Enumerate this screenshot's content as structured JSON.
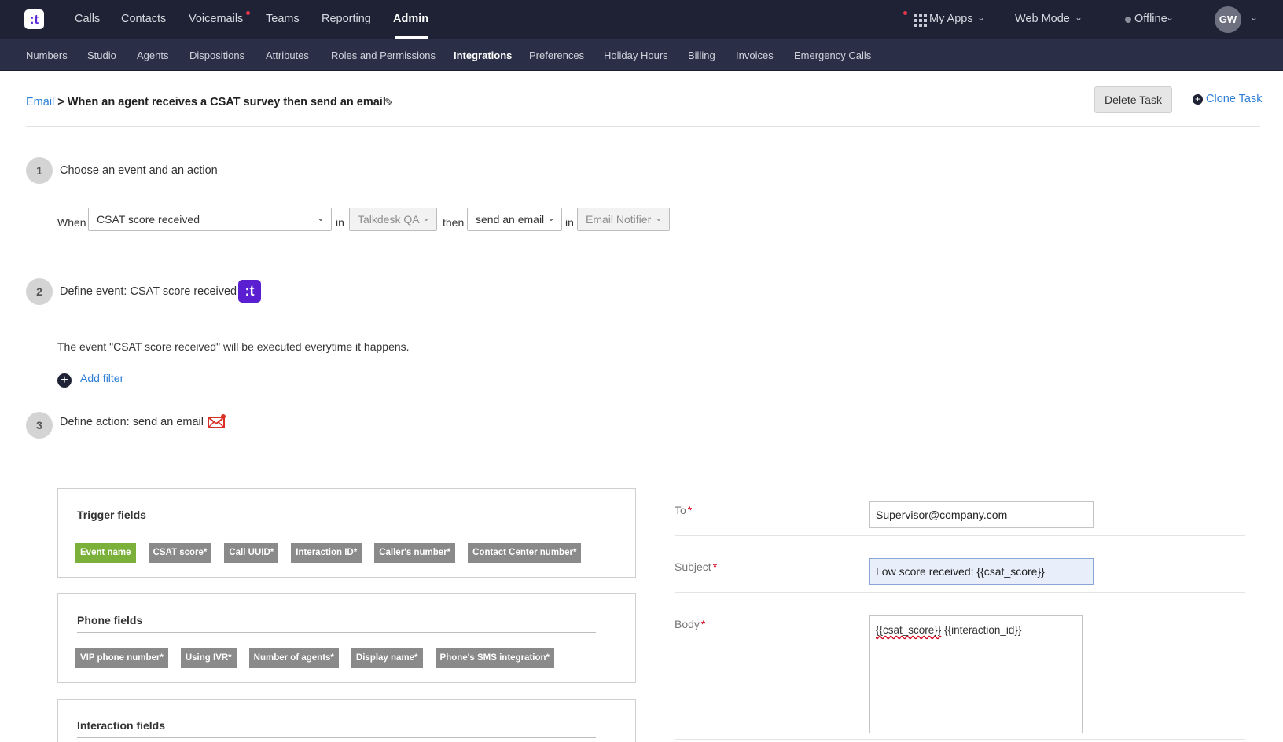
{
  "topnav": {
    "logo": ":t",
    "items": [
      "Calls",
      "Contacts",
      "Voicemails",
      "Teams",
      "Reporting",
      "Admin"
    ],
    "my_apps": "My Apps",
    "mode": "Web Mode",
    "status": "Offline",
    "avatar_initials": "GW"
  },
  "subnav": {
    "items": [
      "Numbers",
      "Studio",
      "Agents",
      "Dispositions",
      "Attributes",
      "Roles and Permissions",
      "Integrations",
      "Preferences",
      "Holiday Hours",
      "Billing",
      "Invoices",
      "Emergency Calls"
    ],
    "active": "Integrations"
  },
  "header": {
    "breadcrumb_link": "Email",
    "separator": ">",
    "title": "When an agent receives a CSAT survey then send an email",
    "delete_label": "Delete Task",
    "clone_label": "Clone Task"
  },
  "step1": {
    "number": "1",
    "title": "Choose an event and an action",
    "when_label": "When",
    "event_value": "CSAT score received",
    "in_label": "in",
    "app_value": "Talkdesk QA",
    "then_label": "then",
    "action_value": "send an email",
    "in_label2": "in",
    "integration_value": "Email Notifier"
  },
  "step2": {
    "number": "2",
    "title": "Define event: CSAT score received",
    "badge": ":t",
    "description": "The event \"CSAT score received\" will be executed everytime it happens.",
    "add_filter": "Add filter"
  },
  "step3": {
    "number": "3",
    "title": "Define action: send an email"
  },
  "panels": {
    "trigger": {
      "title": "Trigger fields",
      "chips": [
        "Event name",
        "CSAT score*",
        "Call UUID*",
        "Interaction ID*",
        "Caller's number*",
        "Contact Center number*"
      ]
    },
    "phone": {
      "title": "Phone fields",
      "chips": [
        "VIP phone number*",
        "Using IVR*",
        "Number of agents*",
        "Display name*",
        "Phone's SMS integration*"
      ]
    },
    "interaction": {
      "title": "Interaction fields"
    }
  },
  "form": {
    "to_label": "To",
    "to_value": "Supervisor@company.com",
    "subject_label": "Subject",
    "subject_value": "Low score received: {{csat_score}}",
    "body_label": "Body",
    "body_part1": "{{csat_score}}",
    "body_part2": " {{interaction_id}}",
    "required_mark": "*"
  },
  "colors": {
    "topbar": "#1f2235",
    "subbar": "#2a2f47",
    "link": "#2e7fd6",
    "chip_green": "#7bb13a",
    "chip_grey": "#8a8a8a",
    "badge_purple": "#5a1fd0",
    "required_red": "#d0021b"
  }
}
